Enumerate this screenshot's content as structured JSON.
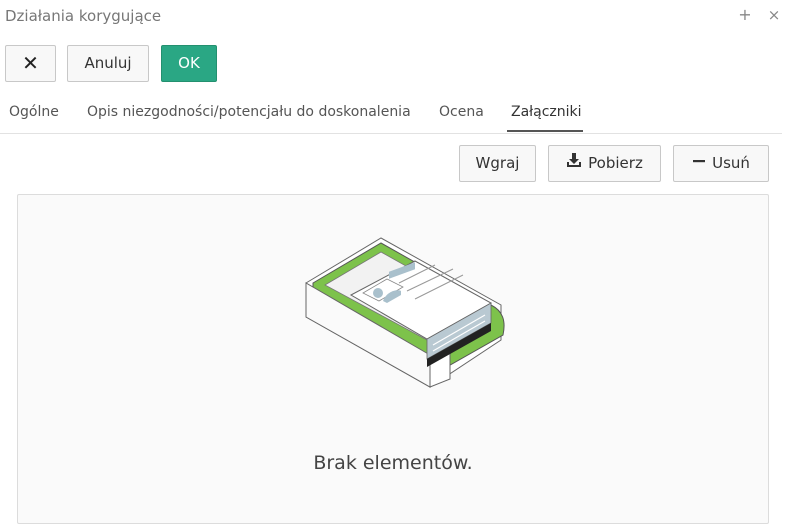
{
  "window": {
    "title": "Działania korygujące",
    "plus": "+",
    "close": "×"
  },
  "toolbar": {
    "close_glyph": "✕",
    "cancel_label": "Anuluj",
    "ok_label": "OK"
  },
  "tabs": [
    {
      "label": "Ogólne"
    },
    {
      "label": "Opis niezgodności/potencjału do doskonalenia"
    },
    {
      "label": "Ocena"
    },
    {
      "label": "Załączniki",
      "active": true
    }
  ],
  "attachments": {
    "upload_label": "Wgraj",
    "download_label": "Pobierz",
    "delete_label": "Usuń",
    "empty_text": "Brak elementów."
  },
  "colors": {
    "ok": "#2aa784",
    "illustration_accent": "#7dc24b"
  }
}
